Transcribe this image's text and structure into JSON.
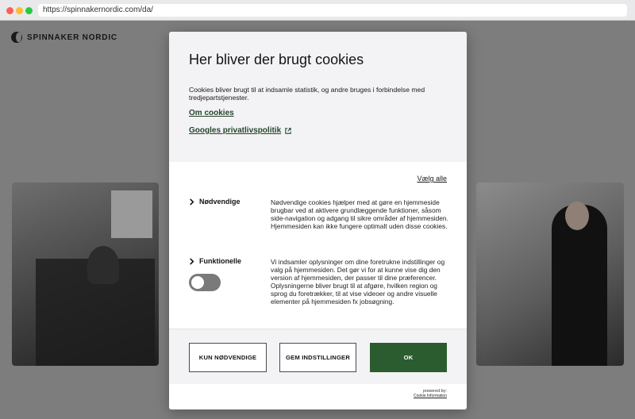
{
  "browser": {
    "url": "https://spinnakernordic.com/da/"
  },
  "site": {
    "brand": "SPINNAKER NORDIC"
  },
  "cookie_dialog": {
    "title": "Her bliver der brugt cookies",
    "intro": "Cookies bliver brugt til at indsamle statistik, og andre bruges i forbindelse med tredjepartstjenester.",
    "about_link": "Om cookies",
    "google_link": "Googles privatlivspolitik",
    "select_all": "Vælg alle",
    "categories": [
      {
        "label": "Nødvendige",
        "description": "Nødvendige cookies hjælper med at gøre en hjemmeside brugbar ved at aktivere grundlæggende funktioner, såsom side-navigation og adgang til sikre områder af hjemmesiden. Hjemmesiden kan ikke fungere optimalt uden disse cookies."
      },
      {
        "label": "Funktionelle",
        "description": "Vi indsamler oplysninger om dine foretrukne indstillinger og valg på hjemmesiden. Det gør vi for at kunne vise dig den version af hjemmesiden, der passer til dine præferencer. Oplysningerne bliver brugt til at afgøre, hvilken region og sprog du foretrækker, til at vise videoer og andre visuelle elementer på hjemmesiden fx jobsøgning.",
        "toggle_on": false
      }
    ],
    "buttons": {
      "necessary_only": "KUN NØDVENDIGE",
      "save_settings": "GEM INDSTILLINGER",
      "ok": "OK"
    },
    "powered_by": "powered by:",
    "powered_brand": "Cookie Information"
  },
  "colors": {
    "accent": "#2b5c2f",
    "link": "#23452b",
    "toggle_off": "#7a7a7a"
  }
}
